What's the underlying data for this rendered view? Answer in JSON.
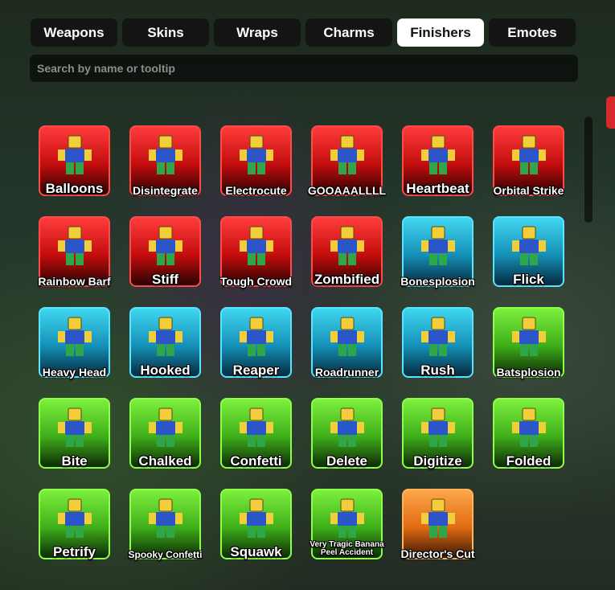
{
  "tabs": [
    {
      "label": "Weapons"
    },
    {
      "label": "Skins"
    },
    {
      "label": "Wraps"
    },
    {
      "label": "Charms"
    },
    {
      "label": "Finishers",
      "active": true
    },
    {
      "label": "Emotes"
    }
  ],
  "search": {
    "placeholder": "Search by name or tooltip",
    "value": ""
  },
  "colors": {
    "red": "#e01818",
    "blue": "#1aa8d8",
    "green": "#4ec41e",
    "orange": "#f08020"
  },
  "items": [
    {
      "name": "Balloons",
      "rarity": "red"
    },
    {
      "name": "Disintegrate",
      "rarity": "red"
    },
    {
      "name": "Electrocute",
      "rarity": "red"
    },
    {
      "name": "GOOAAALLLL",
      "rarity": "red"
    },
    {
      "name": "Heartbeat",
      "rarity": "red"
    },
    {
      "name": "Orbital Strike",
      "rarity": "red"
    },
    {
      "name": "Rainbow Barf",
      "rarity": "red"
    },
    {
      "name": "Stiff",
      "rarity": "red"
    },
    {
      "name": "Tough Crowd",
      "rarity": "red"
    },
    {
      "name": "Zombified",
      "rarity": "red"
    },
    {
      "name": "Bonesplosion",
      "rarity": "blue"
    },
    {
      "name": "Flick",
      "rarity": "blue"
    },
    {
      "name": "Heavy Head",
      "rarity": "blue"
    },
    {
      "name": "Hooked",
      "rarity": "blue"
    },
    {
      "name": "Reaper",
      "rarity": "blue"
    },
    {
      "name": "Roadrunner",
      "rarity": "blue"
    },
    {
      "name": "Rush",
      "rarity": "blue"
    },
    {
      "name": "Batsplosion",
      "rarity": "green"
    },
    {
      "name": "Bite",
      "rarity": "green"
    },
    {
      "name": "Chalked",
      "rarity": "green"
    },
    {
      "name": "Confetti",
      "rarity": "green"
    },
    {
      "name": "Delete",
      "rarity": "green"
    },
    {
      "name": "Digitize",
      "rarity": "green"
    },
    {
      "name": "Folded",
      "rarity": "green"
    },
    {
      "name": "Petrify",
      "rarity": "green"
    },
    {
      "name": "Spooky Confetti",
      "rarity": "green"
    },
    {
      "name": "Squawk",
      "rarity": "green"
    },
    {
      "name": "Very Tragic Banana Peel Accident",
      "rarity": "green"
    },
    {
      "name": "Director's Cut",
      "rarity": "orange"
    }
  ]
}
